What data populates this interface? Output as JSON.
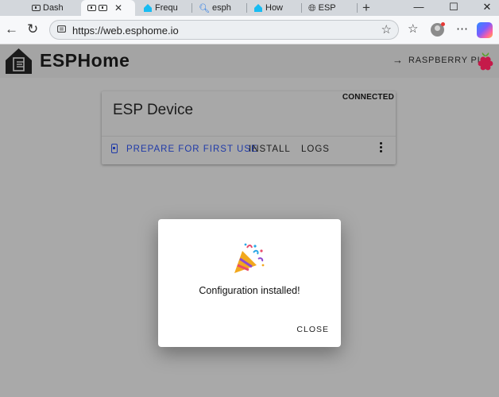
{
  "browser": {
    "tabs": [
      {
        "label": "Dash",
        "icon": "dashboard-icon"
      },
      {
        "label": "",
        "icon": "dashboard-icon",
        "active": true
      },
      {
        "label": "Frequ",
        "icon": "home-assistant-icon"
      },
      {
        "label": "esph",
        "icon": "search-icon"
      },
      {
        "label": "How",
        "icon": "home-assistant-icon"
      },
      {
        "label": "ESP",
        "icon": "globe-icon"
      }
    ],
    "new_tab": "+",
    "window_controls": {
      "minimize": "—",
      "maximize": "☐",
      "close": "✕"
    },
    "url": "https://web.esphome.io"
  },
  "app": {
    "title": "ESPHome",
    "target_label": "RASPBERRY PI"
  },
  "device_card": {
    "status": "CONNECTED",
    "name": "ESP Device",
    "actions": {
      "prepare": "PREPARE FOR FIRST USE",
      "install": "INSTALL",
      "logs": "LOGS"
    },
    "accent_color": "#1f3aa8"
  },
  "dialog": {
    "message": "Configuration installed!",
    "close_label": "CLOSE"
  }
}
